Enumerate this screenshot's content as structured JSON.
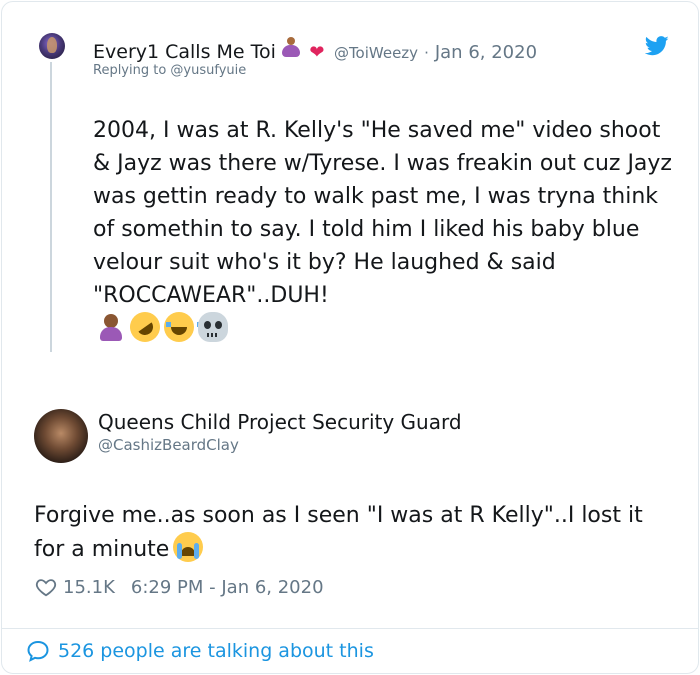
{
  "quoted_tweet": {
    "author_name": "Every1 Calls Me Toi",
    "author_emojis": [
      "person-in-lotus-position-icon",
      "two-hearts-icon"
    ],
    "handle": "@ToiWeezy",
    "separator": "·",
    "date": "Jan 6, 2020",
    "replying_to": "Replying to @yusufyuie",
    "text": "2004, I was at R. Kelly's \"He saved me\" video shoot & Jayz was there w/Tyrese. I was freakin out cuz Jayz was gettin ready to walk past me, I was tryna think of somethin to say. I told him I liked his baby blue velour suit who's it by? He laughed & said \"ROCCAWEAR\"..DUH!",
    "trailing_emojis": [
      "person-facepalming-icon",
      "rolling-on-floor-laughing-icon",
      "face-with-tears-of-joy-icon",
      "skull-icon"
    ]
  },
  "main_tweet": {
    "author_name": "Queens Child Project Security Guard",
    "handle": "@CashizBeardClay",
    "text": "Forgive me..as soon as I seen \"I was at R Kelly\"..I lost it for a minute",
    "trailing_emoji": "loudly-crying-face-icon",
    "like_count": "15.1K",
    "timestamp": "6:29 PM - Jan 6, 2020"
  },
  "footer": {
    "talking_text": "526 people are talking about this"
  },
  "colors": {
    "twitter_blue": "#1da1f2",
    "link_blue": "#1b95e0",
    "muted_gray": "#657786",
    "text_dark": "#14171a"
  }
}
